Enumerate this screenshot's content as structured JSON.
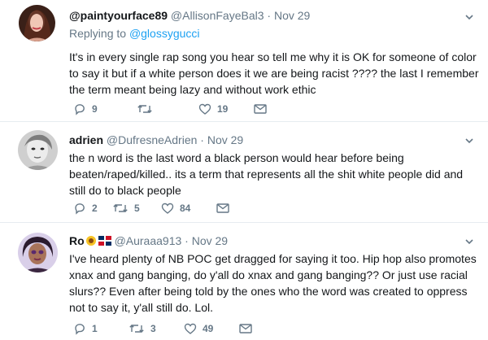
{
  "tweets": [
    {
      "display_name": "@paintyourface89",
      "handle": "@AllisonFayeBal3",
      "separator": "·",
      "date": "Nov 29",
      "replying_to_prefix": "Replying to",
      "replying_to_handle": "@glossygucci",
      "text": "It's in every single rap song you hear so tell me why it is OK for someone of color to say it but if a white person does it we are being racist ???? the last I remember the term meant being lazy and without work ethic",
      "replies": "9",
      "retweets": "",
      "likes": "19"
    },
    {
      "display_name": "adrien",
      "handle": "@DufresneAdrien",
      "separator": "·",
      "date": "Nov 29",
      "text": "the n word is the last word a black person would hear before being beaten/raped/killed.. its a term that represents all the shit white people did and still do to black people",
      "replies": "2",
      "retweets": "5",
      "likes": "84"
    },
    {
      "display_name": "Ro",
      "handle": "@Auraaa913",
      "separator": "·",
      "date": "Nov 29",
      "text": "I've heard plenty of NB POC get dragged for saying it too. Hip hop also promotes xnax and gang banging, do y'all do xnax and gang banging?? Or just use racial slurs?? Even after being told by the ones who the word was created to oppress  not to say it, y'all still do. Lol.",
      "replies": "1",
      "retweets": "3",
      "likes": "49"
    }
  ],
  "colors": {
    "link": "#1da1f2",
    "secondary": "#657786",
    "text": "#14171a",
    "divider": "#e6ecf0"
  },
  "icons": [
    "reply-icon",
    "retweet-icon",
    "like-icon",
    "dm-icon",
    "chevron-down-icon",
    "sunflower-emoji",
    "dominican-flag-emoji"
  ]
}
